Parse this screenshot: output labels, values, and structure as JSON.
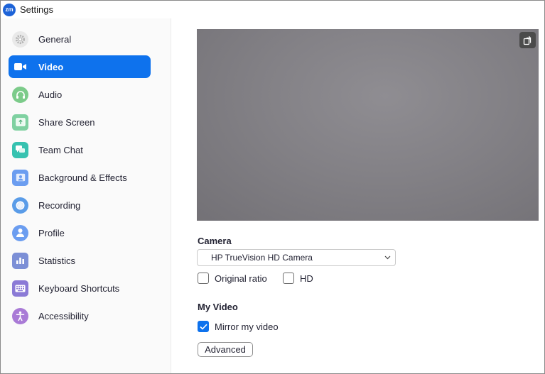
{
  "window": {
    "title": "Settings",
    "logo_text": "zm"
  },
  "sidebar": {
    "active_color": "#0e72ed",
    "items": [
      {
        "label": "General",
        "icon": "gear-icon",
        "color": "#e8e8e8"
      },
      {
        "label": "Video",
        "icon": "video-camera-icon",
        "color": "#0e72ed",
        "active": true
      },
      {
        "label": "Audio",
        "icon": "headphones-icon",
        "color": "#7ccb8a"
      },
      {
        "label": "Share Screen",
        "icon": "share-screen-icon",
        "color": "#7fd1a1"
      },
      {
        "label": "Team Chat",
        "icon": "chat-bubbles-icon",
        "color": "#36c2b0"
      },
      {
        "label": "Background & Effects",
        "icon": "background-icon",
        "color": "#6b9df0"
      },
      {
        "label": "Recording",
        "icon": "record-icon",
        "color": "#5a9ce8"
      },
      {
        "label": "Profile",
        "icon": "person-icon",
        "color": "#6b9df0"
      },
      {
        "label": "Statistics",
        "icon": "bar-chart-icon",
        "color": "#7c8fd6"
      },
      {
        "label": "Keyboard Shortcuts",
        "icon": "keyboard-icon",
        "color": "#8b7ad6"
      },
      {
        "label": "Accessibility",
        "icon": "accessibility-icon",
        "color": "#a97ad6"
      }
    ]
  },
  "video": {
    "camera": {
      "section_label": "Camera",
      "selected": "HP TrueVision HD Camera"
    },
    "options": [
      {
        "label": "Original ratio",
        "checked": false
      },
      {
        "label": "HD",
        "checked": false
      }
    ],
    "my_video": {
      "section_label": "My Video",
      "mirror": {
        "label": "Mirror my video",
        "checked": true
      }
    },
    "advanced_label": "Advanced"
  }
}
